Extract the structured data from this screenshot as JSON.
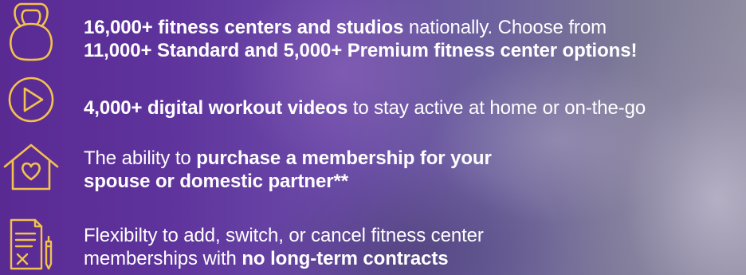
{
  "colors": {
    "icon_stroke": "#f2c14e",
    "text": "#ffffff"
  },
  "features": [
    {
      "icon": "kettlebell-icon",
      "line1_bold": "16,000+ fitness centers and studios",
      "line1_regular": " nationally. Choose from",
      "line2_bold": "11,000+ Standard and 5,000+ Premium fitness center options!"
    },
    {
      "icon": "play-button-icon",
      "line1_bold": "4,000+ digital workout videos",
      "line1_regular": " to stay active at home or on-the-go"
    },
    {
      "icon": "house-heart-icon",
      "line1_regular": "The ability to ",
      "line1_bold": "purchase a membership for your",
      "line2_bold": "spouse or domestic partner**"
    },
    {
      "icon": "contract-cancel-icon",
      "line1_regular": "Flexibilty to add, switch, or cancel fitness center",
      "line2_regular": "memberships with ",
      "line2_bold": "no long-term contracts"
    }
  ]
}
